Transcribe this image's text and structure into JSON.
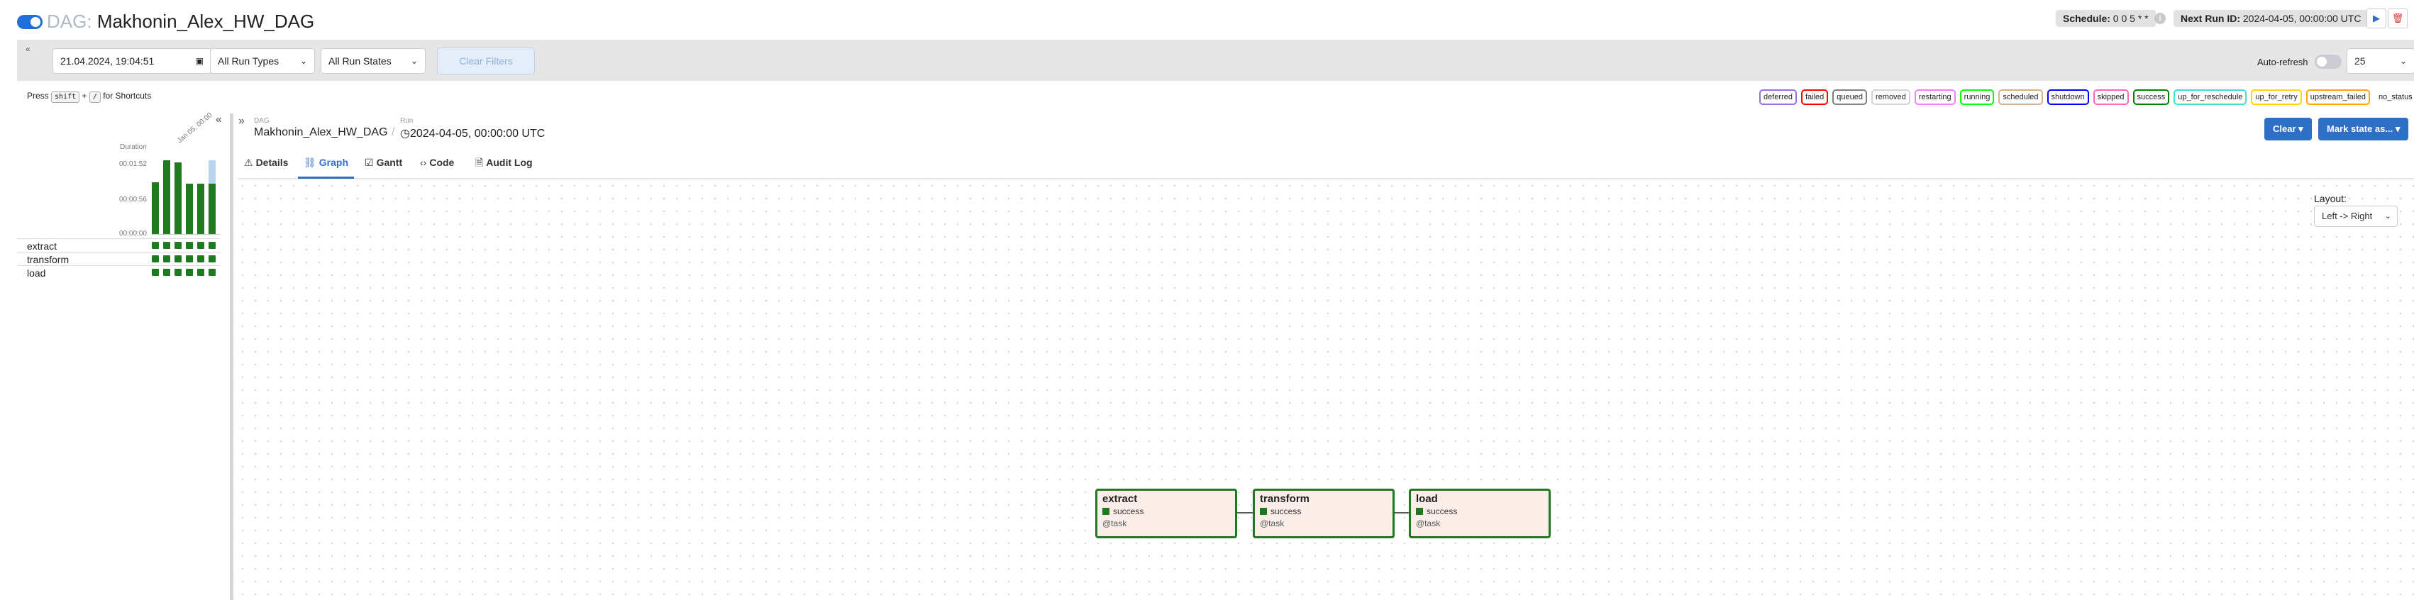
{
  "header": {
    "dag_label": "DAG:",
    "dag_name": "Makhonin_Alex_HW_DAG",
    "schedule_label": "Schedule:",
    "schedule_value": "0 0 5 * *",
    "next_run_label": "Next Run ID:",
    "next_run_value": "2024-04-05, 00:00:00 UTC",
    "info_icon": "i",
    "play_icon": "▶",
    "delete_icon": "🗑"
  },
  "filters": {
    "collapse_icon": "«",
    "date_value": "21.04.2024, 19:04:51",
    "calendar_icon": "▣",
    "run_types": "All Run Types",
    "run_states": "All Run States",
    "clear_filters": "Clear Filters",
    "auto_refresh_label": "Auto-refresh",
    "num_runs": "25"
  },
  "shortcuts": {
    "press": "Press",
    "key1": "shift",
    "plus": "+",
    "key2": "/",
    "for": "for Shortcuts"
  },
  "legend": [
    {
      "label": "deferred",
      "color": "#9370db"
    },
    {
      "label": "failed",
      "color": "#ff0000"
    },
    {
      "label": "queued",
      "color": "#808080"
    },
    {
      "label": "removed",
      "color": "#d3d3d3"
    },
    {
      "label": "restarting",
      "color": "#ee82ee"
    },
    {
      "label": "running",
      "color": "#00ff00"
    },
    {
      "label": "scheduled",
      "color": "#d2b48c"
    },
    {
      "label": "shutdown",
      "color": "#0000ff"
    },
    {
      "label": "skipped",
      "color": "#ff69b4"
    },
    {
      "label": "success",
      "color": "#008000"
    },
    {
      "label": "up_for_reschedule",
      "color": "#40e0d0"
    },
    {
      "label": "up_for_retry",
      "color": "#ffd700"
    },
    {
      "label": "upstream_failed",
      "color": "#ffa500"
    },
    {
      "label": "no_status",
      "color": "transparent"
    }
  ],
  "grid": {
    "collapse_icon": "«",
    "duration_label": "Duration",
    "date_label": "Jan 05, 00:00",
    "y_ticks": [
      "00:01:52",
      "00:00:56",
      "00:00:00"
    ],
    "run_fractions": [
      0.7,
      1.0,
      0.97,
      0.68,
      0.68,
      0.68
    ],
    "selected_fraction": 1.0,
    "tasks": [
      {
        "name": "extract"
      },
      {
        "name": "transform"
      },
      {
        "name": "load"
      }
    ],
    "runs_per_task": 6
  },
  "details": {
    "expand_icon": "»",
    "dag_lbl": "DAG",
    "dag_val": "Makhonin_Alex_HW_DAG",
    "sep": "/",
    "run_lbl": "Run",
    "run_icon": "◷",
    "run_val": "2024-04-05, 00:00:00 UTC",
    "clear_btn": "Clear ▾",
    "mark_state_btn": "Mark state as... ▾"
  },
  "tabs": [
    {
      "icon": "⚠",
      "label": "Details"
    },
    {
      "icon": "⛓",
      "label": "Graph"
    },
    {
      "icon": "☑",
      "label": "Gantt"
    },
    {
      "icon": "‹›",
      "label": "Code"
    },
    {
      "icon": "🗎",
      "label": "Audit Log"
    }
  ],
  "graph": {
    "layout_label": "Layout:",
    "layout_value": "Left -> Right",
    "nodes": [
      {
        "name": "extract",
        "state": "success",
        "operator": "@task"
      },
      {
        "name": "transform",
        "state": "success",
        "operator": "@task"
      },
      {
        "name": "load",
        "state": "success",
        "operator": "@task"
      }
    ]
  }
}
